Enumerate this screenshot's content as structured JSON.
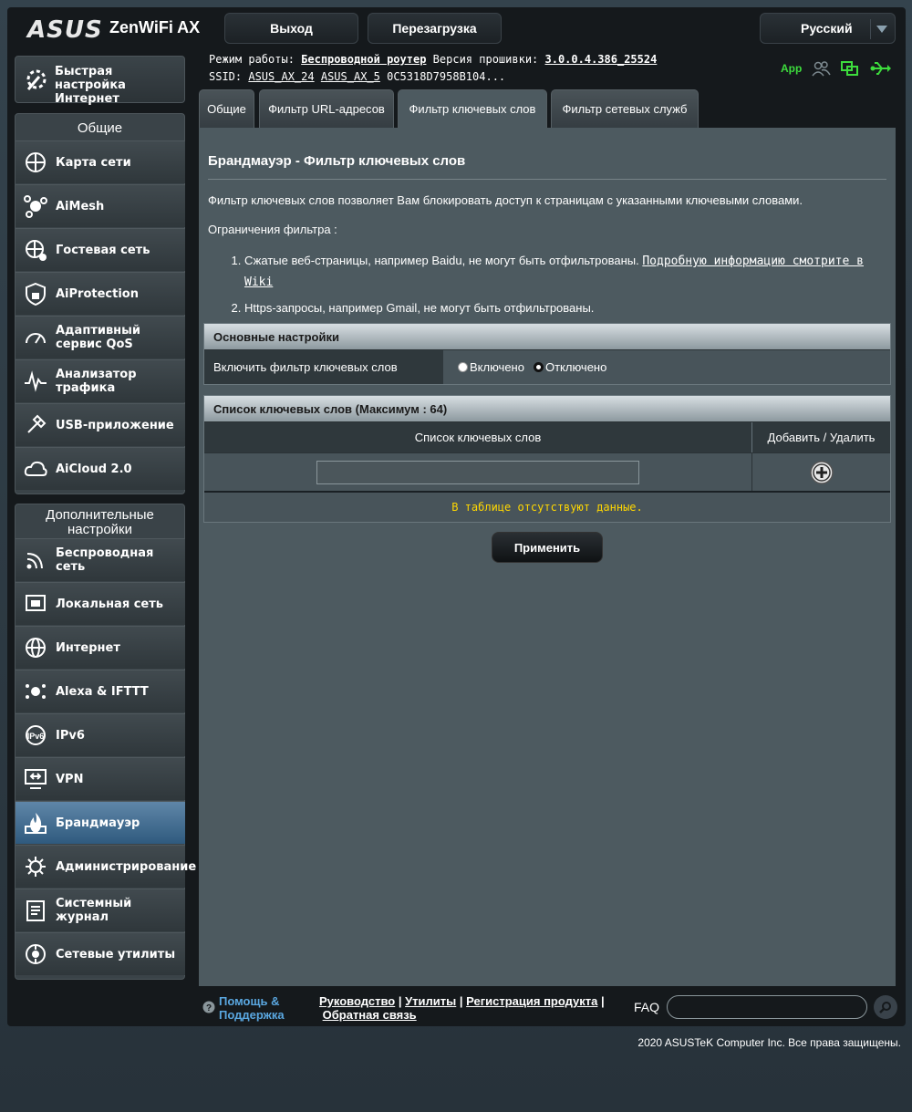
{
  "header": {
    "brand": "ASUS",
    "product": "ZenWiFi AX",
    "logout_label": "Выход",
    "reboot_label": "Перезагрузка",
    "language": "Русский"
  },
  "info": {
    "mode_label": "Режим работы:",
    "mode_value": "Беспроводной роутер",
    "firmware_label": "Версия прошивки:",
    "firmware_value": "3.0.0.4.386_25524",
    "ssid_label": "SSID:",
    "ssid_1": "ASUS_AX_24",
    "ssid_2": "ASUS_AX_5",
    "ssid_3": "0C5318D7958B104...",
    "app_label": "App"
  },
  "sidebar": {
    "quick_setup": "Быстрая настройка Интернет",
    "general_header": "Общие",
    "general_items": [
      {
        "label": "Карта сети",
        "icon": "network-map-icon"
      },
      {
        "label": "AiMesh",
        "icon": "aimesh-icon"
      },
      {
        "label": "Гостевая сеть",
        "icon": "guest-network-icon"
      },
      {
        "label": "AiProtection",
        "icon": "aiprotection-icon"
      },
      {
        "label": "Адаптивный сервис QoS",
        "icon": "qos-icon"
      },
      {
        "label": "Анализатор трафика",
        "icon": "traffic-analyzer-icon"
      },
      {
        "label": "USB-приложение",
        "icon": "usb-app-icon"
      },
      {
        "label": "AiCloud 2.0",
        "icon": "aicloud-icon"
      }
    ],
    "advanced_header": "Дополнительные настройки",
    "advanced_items": [
      {
        "label": "Беспроводная сеть",
        "icon": "wireless-icon"
      },
      {
        "label": "Локальная сеть",
        "icon": "lan-icon"
      },
      {
        "label": "Интернет",
        "icon": "wan-icon"
      },
      {
        "label": "Alexa & IFTTT",
        "icon": "alexa-icon"
      },
      {
        "label": "IPv6",
        "icon": "ipv6-icon"
      },
      {
        "label": "VPN",
        "icon": "vpn-icon"
      },
      {
        "label": "Брандмауэр",
        "icon": "firewall-icon"
      },
      {
        "label": "Администрирование",
        "icon": "administration-icon"
      },
      {
        "label": "Системный журнал",
        "icon": "system-log-icon"
      },
      {
        "label": "Сетевые утилиты",
        "icon": "network-tools-icon"
      }
    ]
  },
  "tabs": [
    "Общие",
    "Фильтр URL-адресов",
    "Фильтр ключевых слов",
    "Фильтр сетевых служб"
  ],
  "main": {
    "title": "Брандмауэр - Фильтр ключевых слов",
    "description": "Фильтр ключевых слов позволяет Вам блокировать доступ к страницам с указанными ключевыми словами.",
    "limitations_label": "Ограничения фильтра :",
    "limit_1": "Сжатые веб-страницы, например Baidu, не могут быть отфильтрованы. ",
    "limit_1_link": "Подробную информацию смотрите в Wiki",
    "limit_2": "Https-запросы, например Gmail, не могут быть отфильтрованы.",
    "basic_header": "Основные настройки",
    "enable_label": "Включить фильтр ключевых слов",
    "radio_on": "Включено",
    "radio_off": "Отключено",
    "list_header": "Список ключевых слов (Максимум : 64)",
    "col_keyword": "Список ключевых слов",
    "col_action": "Добавить / Удалить",
    "keyword_value": "",
    "no_data": "В таблице отсутствуют данные.",
    "apply_label": "Применить"
  },
  "footer": {
    "help_label": "Помощь & Поддержка",
    "manual": "Руководство",
    "utilities": "Утилиты",
    "registration": "Регистрация продукта",
    "feedback": "Обратная связь",
    "faq": "FAQ",
    "copyright": "2020 ASUSTeK Computer Inc. Все права защищены."
  }
}
